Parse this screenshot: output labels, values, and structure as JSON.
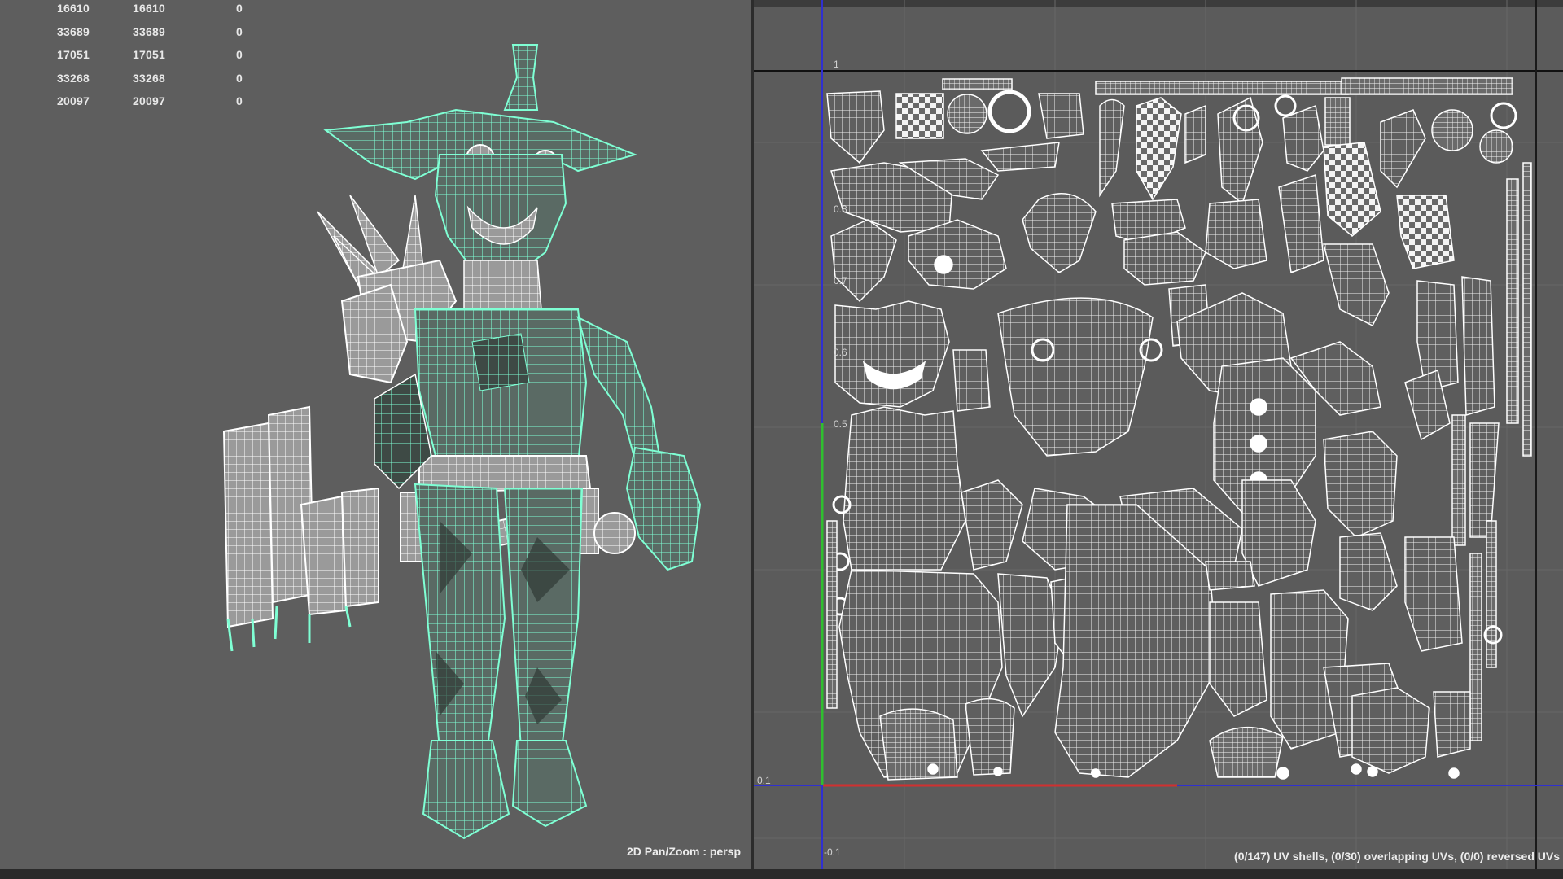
{
  "viewport": {
    "stats": [
      [
        "16610",
        "16610",
        "0"
      ],
      [
        "33689",
        "33689",
        "0"
      ],
      [
        "17051",
        "17051",
        "0"
      ],
      [
        "33268",
        "33268",
        "0"
      ],
      [
        "20097",
        "20097",
        "0"
      ]
    ],
    "camera_label": "2D Pan/Zoom : persp",
    "wire_color": "#7fffd4",
    "wire_secondary": "#ffffff"
  },
  "uv_editor": {
    "ticks": {
      "top": "1",
      "v08": "0.8",
      "v07": "0.7",
      "v06": "0.6",
      "v05": "0.5",
      "bottom_left": "0.1",
      "below": "-0.1"
    },
    "status": "(0/147) UV shells, (0/30) overlapping UVs, (0/0) reversed UVs",
    "axis_colors": {
      "u": "#3030d0",
      "v_green": "#2fbf2f",
      "u_red": "#d03030"
    }
  }
}
